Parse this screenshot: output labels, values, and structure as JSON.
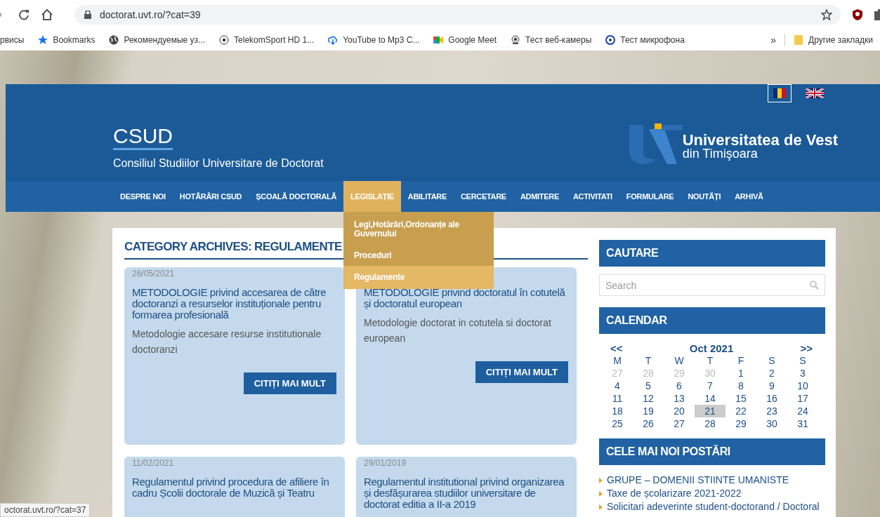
{
  "browser": {
    "address": "doctorat.uvt.ro/?cat=39",
    "bookmarks": [
      {
        "kind": "none",
        "label": "рвисы"
      },
      {
        "kind": "star",
        "label": "Bookmarks"
      },
      {
        "kind": "globe",
        "label": "Рекомендуемые уз..."
      },
      {
        "kind": "ball",
        "label": "TelekomSport HD 1..."
      },
      {
        "kind": "download",
        "label": "YouTube to Mp3 C..."
      },
      {
        "kind": "video",
        "label": "Google Meet"
      },
      {
        "kind": "webcam",
        "label": "Тест веб-камеры"
      },
      {
        "kind": "mic",
        "label": "Тест микрофона"
      }
    ],
    "overflow": "»",
    "other_bookmarks": "Другие закладки"
  },
  "header": {
    "languages": [
      {
        "kind": "ro",
        "selected": true
      },
      {
        "kind": "uk",
        "selected": false
      }
    ],
    "site_title": "CSUD",
    "site_subtitle": "Consiliul Studiilor Universitare de Doctorat",
    "logo_line_1": "Universitatea de Vest",
    "logo_line_2": "din Timişoara"
  },
  "nav": [
    {
      "label": "DESPRE NOI",
      "selected": false
    },
    {
      "label": "HOTĂRÂRI CSUD",
      "selected": false
    },
    {
      "label": "ȘCOALĂ DOCTORALĂ",
      "selected": false
    },
    {
      "label": "LEGISLAȚIE",
      "selected": true,
      "submenu": [
        {
          "label": "Legi,Hotărâri,Ordonanțe ale Guvernului",
          "selected": false
        },
        {
          "label": "Proceduri",
          "selected": false
        },
        {
          "label": "Regulamente",
          "selected": true
        }
      ]
    },
    {
      "label": "ABILITARE",
      "selected": false
    },
    {
      "label": "CERCETARE",
      "selected": false
    },
    {
      "label": "ADMITERE",
      "selected": false
    },
    {
      "label": "ACTIVITATI",
      "selected": false
    },
    {
      "label": "FORMULARE",
      "selected": false
    },
    {
      "label": "NOUTĂȚI",
      "selected": false
    },
    {
      "label": "ARHIVĂ",
      "selected": false
    }
  ],
  "archive": {
    "heading": "CATEGORY ARCHIVES: REGULAMENTE",
    "posts": [
      {
        "date": "26/05/2021",
        "title": "METODOLOGIE privind accesarea de către doctoranzi a resurselor instituționale pentru formarea profesională",
        "excerpt": "Metodologie accesare resurse institutionale doctoranzi",
        "button": "CITIȚI MAI MULT"
      },
      {
        "title": "METODOLOGIE privind doctoratul în cotutelă și doctoratul european",
        "excerpt": "Metodologie doctorat in cotutela si doctorat european",
        "button": "CITIȚI MAI MULT"
      },
      {
        "date": "11/02/2021",
        "title": "Regulamentul privind procedura de afiliere în cadru Școlii doctorale de Muzică și Teatru"
      },
      {
        "date": "29/01/2019",
        "title": "Regulamentul institutional privind organizarea și desfășurarea studiilor universitare de doctorat editia a II-a 2019"
      }
    ]
  },
  "sidebar": {
    "search_title": "CAUTARE",
    "search_placeholder": "Search",
    "calendar_title": "CALENDAR",
    "prev": "<<",
    "month": "Oct 2021",
    "next": ">>",
    "weekdays": [
      "M",
      "T",
      "W",
      "T",
      "F",
      "S",
      "S"
    ],
    "weeks": [
      [
        {
          "day": "27",
          "muted": true,
          "today": false
        },
        {
          "day": "28",
          "muted": true,
          "today": false
        },
        {
          "day": "29",
          "muted": true,
          "today": false
        },
        {
          "day": "30",
          "muted": true,
          "today": false
        },
        {
          "day": "1",
          "muted": false,
          "today": false
        },
        {
          "day": "2",
          "muted": false,
          "today": false
        },
        {
          "day": "3",
          "muted": false,
          "today": false
        }
      ],
      [
        {
          "day": "4",
          "muted": false,
          "today": false
        },
        {
          "day": "5",
          "muted": false,
          "today": false
        },
        {
          "day": "6",
          "muted": false,
          "today": false
        },
        {
          "day": "7",
          "muted": false,
          "today": false
        },
        {
          "day": "8",
          "muted": false,
          "today": false
        },
        {
          "day": "9",
          "muted": false,
          "today": false
        },
        {
          "day": "10",
          "muted": false,
          "today": false
        }
      ],
      [
        {
          "day": "11",
          "muted": false,
          "today": false
        },
        {
          "day": "12",
          "muted": false,
          "today": false
        },
        {
          "day": "13",
          "muted": false,
          "today": false
        },
        {
          "day": "14",
          "muted": false,
          "today": false
        },
        {
          "day": "15",
          "muted": false,
          "today": false
        },
        {
          "day": "16",
          "muted": false,
          "today": false
        },
        {
          "day": "17",
          "muted": false,
          "today": false
        }
      ],
      [
        {
          "day": "18",
          "muted": false,
          "today": false
        },
        {
          "day": "19",
          "muted": false,
          "today": false
        },
        {
          "day": "20",
          "muted": false,
          "today": false
        },
        {
          "day": "21",
          "muted": false,
          "today": true
        },
        {
          "day": "22",
          "muted": false,
          "today": false
        },
        {
          "day": "23",
          "muted": false,
          "today": false
        },
        {
          "day": "24",
          "muted": false,
          "today": false
        }
      ],
      [
        {
          "day": "25",
          "muted": false,
          "today": false
        },
        {
          "day": "26",
          "muted": false,
          "today": false
        },
        {
          "day": "27",
          "muted": false,
          "today": false
        },
        {
          "day": "28",
          "muted": false,
          "today": false
        },
        {
          "day": "29",
          "muted": false,
          "today": false
        },
        {
          "day": "30",
          "muted": false,
          "today": false
        },
        {
          "day": "31",
          "muted": false,
          "today": false
        }
      ]
    ],
    "recent_title": "CELE MAI NOI POSTĂRI",
    "recent": [
      "GRUPE – DOMENII STIINTE UMANISTE",
      "Taxe de școlarizare 2021-2022",
      "Solicitari adeverinte student-doctorand / Doctoral"
    ]
  },
  "status_url": "octorat.uvt.ro/?cat=37"
}
